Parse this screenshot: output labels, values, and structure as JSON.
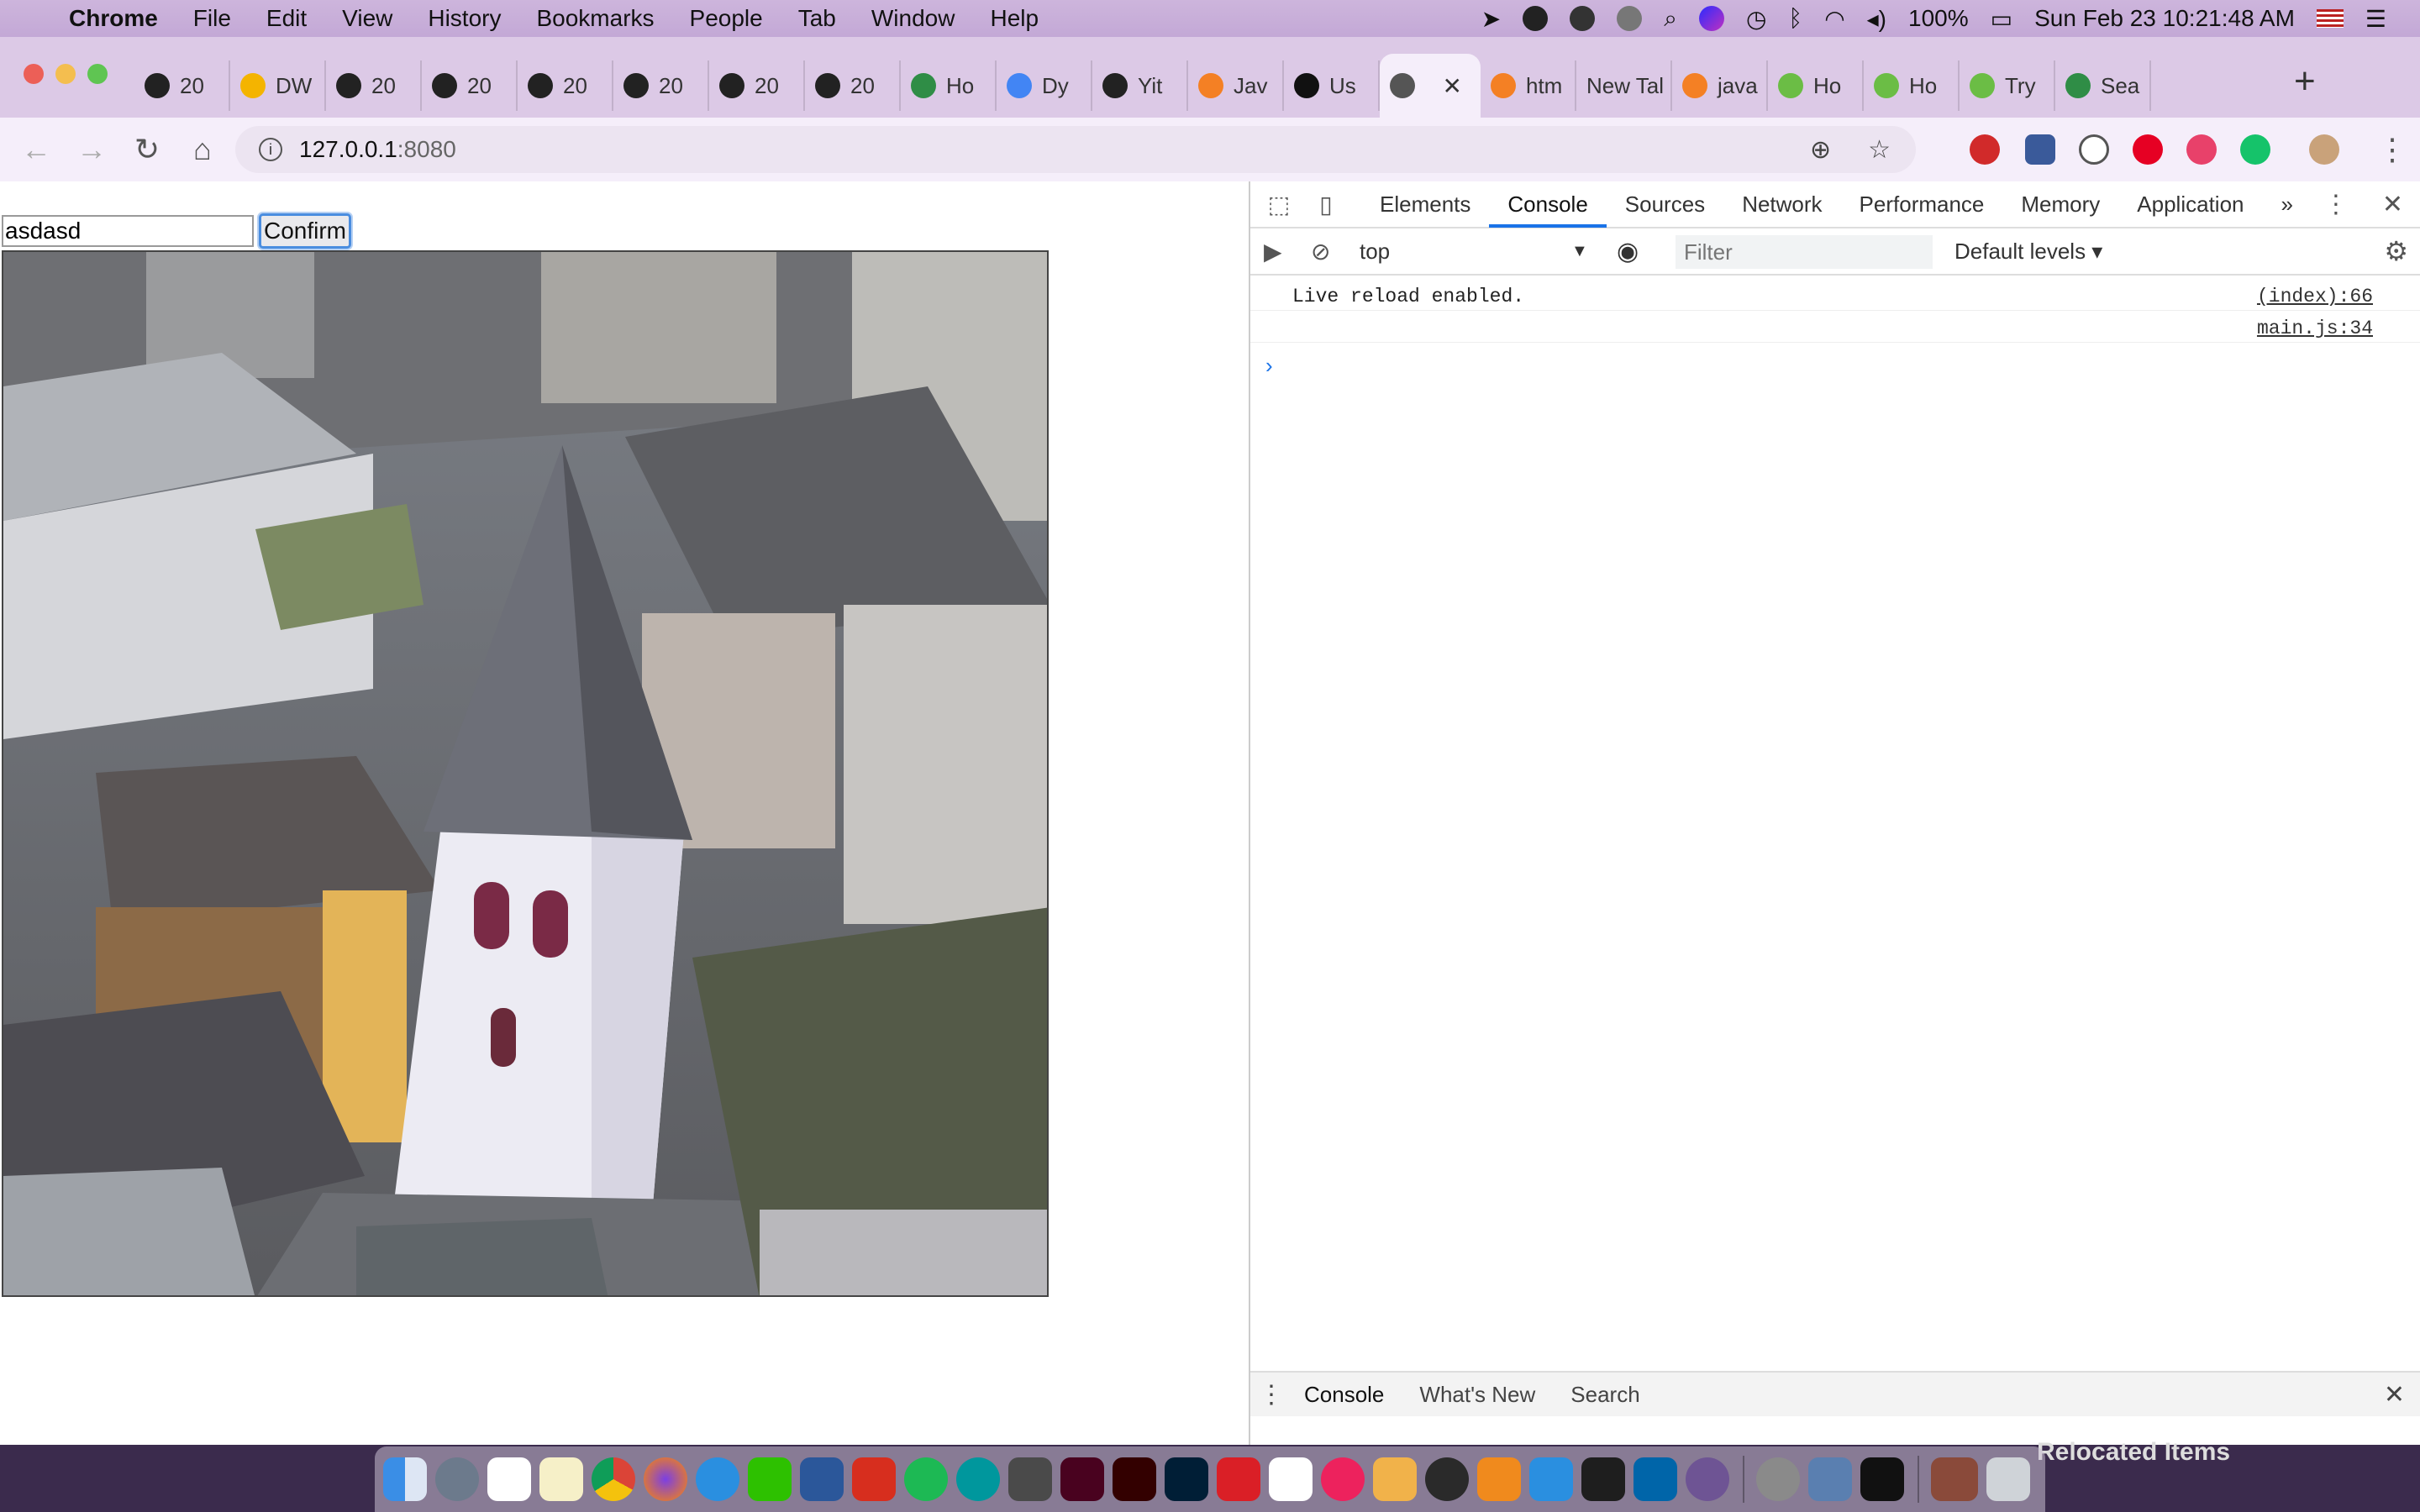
{
  "menubar": {
    "items": [
      "Chrome",
      "File",
      "Edit",
      "View",
      "History",
      "Bookmarks",
      "People",
      "Tab",
      "Window",
      "Help"
    ],
    "battery": "100%",
    "clock": "Sun Feb 23  10:21:48 AM"
  },
  "tabs": [
    {
      "label": "20",
      "icon": "github-icon"
    },
    {
      "label": "DW",
      "icon": "slides-icon"
    },
    {
      "label": "20",
      "icon": "github-icon"
    },
    {
      "label": "20",
      "icon": "github-icon"
    },
    {
      "label": "20",
      "icon": "github-icon"
    },
    {
      "label": "20",
      "icon": "github-icon"
    },
    {
      "label": "20",
      "icon": "github-icon"
    },
    {
      "label": "20",
      "icon": "github-icon"
    },
    {
      "label": "Ho",
      "icon": "geeks-icon"
    },
    {
      "label": "Dy",
      "icon": "docs-icon"
    },
    {
      "label": "Yit",
      "icon": "github-icon"
    },
    {
      "label": "Jav",
      "icon": "stackoverflow-icon"
    },
    {
      "label": "Us",
      "icon": "imdb-icon"
    },
    {
      "label": "",
      "icon": "globe-icon",
      "active": true
    },
    {
      "label": "htm",
      "icon": "stackoverflow-icon"
    },
    {
      "label": "New Tal",
      "icon": ""
    },
    {
      "label": "java",
      "icon": "stackoverflow-icon"
    },
    {
      "label": "Ho",
      "icon": "w3schools-icon"
    },
    {
      "label": "Ho",
      "icon": "w3schools-icon"
    },
    {
      "label": "Try",
      "icon": "w3schools-icon"
    },
    {
      "label": "Sea",
      "icon": "geeks-icon"
    }
  ],
  "omnibox": {
    "host": "127.0.0.1",
    "port": ":8080"
  },
  "page": {
    "input_value": "asdasd",
    "confirm_label": "Confirm"
  },
  "devtools": {
    "tabs": [
      "Elements",
      "Console",
      "Sources",
      "Network",
      "Performance",
      "Memory",
      "Application"
    ],
    "active_tab": "Console",
    "context": "top",
    "filter_placeholder": "Filter",
    "levels": "Default levels ▾",
    "logs": [
      {
        "message": "Live reload enabled.",
        "source": "(index):66"
      },
      {
        "message": "",
        "source": "main.js:34"
      }
    ],
    "drawer_tabs": [
      "Console",
      "What's New",
      "Search"
    ]
  },
  "dock": {
    "label": "Relocated Items",
    "colors": {
      "accent": "#1a73e8",
      "confirm_border": "#4a8de0"
    }
  }
}
